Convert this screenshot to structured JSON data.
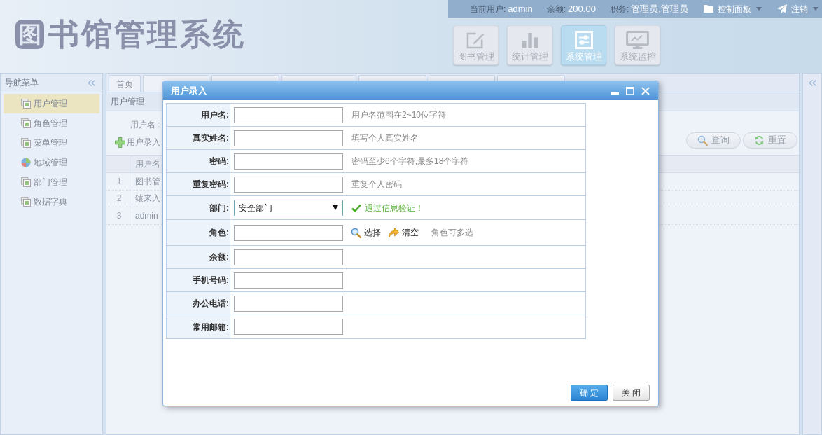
{
  "header": {
    "logo": {
      "mark": "图",
      "title": "书馆管理系统"
    },
    "user_info": [
      {
        "label": "当前用户:",
        "value": "admin"
      },
      {
        "label": "余额:",
        "value": "200.00"
      },
      {
        "label": "职务:",
        "value": "管理员,管理员"
      }
    ],
    "menus": [
      {
        "label": "控制面板"
      },
      {
        "label": "注销"
      }
    ],
    "modules": [
      {
        "label": "图书管理",
        "selected": false
      },
      {
        "label": "统计管理",
        "selected": false
      },
      {
        "label": "系统管理",
        "selected": true
      },
      {
        "label": "系统监控",
        "selected": false
      }
    ]
  },
  "sidebar": {
    "title": "导航菜单",
    "items": [
      {
        "label": "用户管理",
        "selected": true
      },
      {
        "label": "角色管理",
        "selected": false
      },
      {
        "label": "菜单管理",
        "selected": false
      },
      {
        "label": "地域管理",
        "selected": false
      },
      {
        "label": "部门管理",
        "selected": false
      },
      {
        "label": "数据字典",
        "selected": false
      }
    ]
  },
  "tabs": [
    {
      "kind": "text",
      "label": "首页"
    },
    {
      "kind": "covered"
    },
    {
      "kind": "covered"
    },
    {
      "kind": "covered"
    },
    {
      "kind": "covered"
    },
    {
      "kind": "covered"
    },
    {
      "kind": "covered"
    }
  ],
  "panel": {
    "title": "用户管理",
    "search_label": "用户名 :",
    "toolbar_button": "用户录入",
    "buttons": [
      "查询",
      "重置"
    ],
    "table": {
      "columns": [
        "用户名"
      ],
      "rows": [
        {
          "number": "1",
          "username": "图书管"
        },
        {
          "number": "2",
          "username": "猿来入"
        },
        {
          "number": "3",
          "username": "admin"
        }
      ]
    }
  },
  "dialog": {
    "title": "用户录入",
    "fields": [
      {
        "kind": "input",
        "label": "用户名:",
        "hint": "用户名范围在2~10位字符"
      },
      {
        "kind": "input",
        "label": "真实姓名:",
        "hint": "填写个人真实姓名"
      },
      {
        "kind": "input",
        "label": "密码:",
        "hint": "密码至少6个字符,最多18个字符"
      },
      {
        "kind": "input",
        "label": "重复密码:",
        "hint": "重复个人密码"
      },
      {
        "kind": "select",
        "label": "部门:",
        "value": "安全部门",
        "validation": "通过信息验证！"
      },
      {
        "kind": "picker",
        "label": "角色:",
        "actions": [
          "选择",
          "清空"
        ],
        "hint": "角色可多选"
      },
      {
        "kind": "input",
        "label": "余额:"
      },
      {
        "kind": "input",
        "label": "手机号码:"
      },
      {
        "kind": "input",
        "label": "办公电话:"
      },
      {
        "kind": "input",
        "label": "常用邮箱:"
      }
    ],
    "buttons": [
      {
        "label": "确定",
        "kind": "primary"
      },
      {
        "label": "关闭",
        "kind": "default"
      }
    ]
  }
}
